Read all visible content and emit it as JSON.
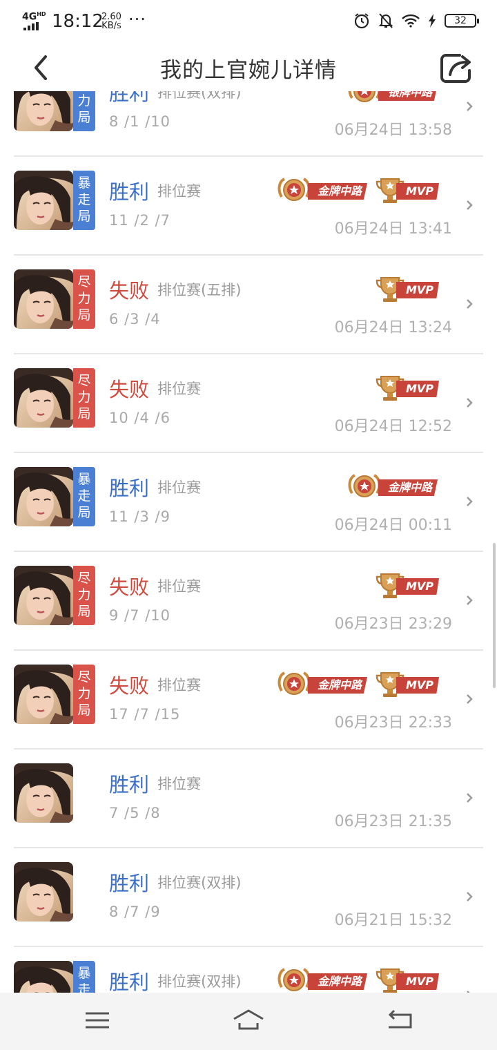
{
  "status_bar": {
    "network": "4G",
    "network_sup": "HD",
    "time": "18:12",
    "speed_value": "2.60",
    "speed_unit": "KB/s",
    "dots": "···",
    "battery": "32"
  },
  "header": {
    "title": "我的上官婉儿详情"
  },
  "matches": [
    {
      "result": "胜利",
      "outcome": "win",
      "mode": "排位赛(双排)",
      "kda": "8 /1 /10",
      "time": "06月24日 13:58",
      "tag": "尽力局",
      "tag_color": "blue",
      "badges": [
        {
          "type": "silver-medal",
          "label": "银牌中路"
        }
      ]
    },
    {
      "result": "胜利",
      "outcome": "win",
      "mode": "排位赛",
      "kda": "11 /2 /7",
      "time": "06月24日 13:41",
      "tag": "暴走局",
      "tag_color": "blue",
      "badges": [
        {
          "type": "gold-medal",
          "label": "金牌中路"
        },
        {
          "type": "mvp-trophy",
          "label": "MVP"
        }
      ]
    },
    {
      "result": "失败",
      "outcome": "lose",
      "mode": "排位赛(五排)",
      "kda": "6 /3 /4",
      "time": "06月24日 13:24",
      "tag": "尽力局",
      "tag_color": "red",
      "badges": [
        {
          "type": "mvp-trophy",
          "label": "MVP"
        }
      ]
    },
    {
      "result": "失败",
      "outcome": "lose",
      "mode": "排位赛",
      "kda": "10 /4 /6",
      "time": "06月24日 12:52",
      "tag": "尽力局",
      "tag_color": "red",
      "badges": [
        {
          "type": "mvp-trophy",
          "label": "MVP"
        }
      ]
    },
    {
      "result": "胜利",
      "outcome": "win",
      "mode": "排位赛",
      "kda": "11 /3 /9",
      "time": "06月24日 00:11",
      "tag": "暴走局",
      "tag_color": "blue",
      "badges": [
        {
          "type": "gold-medal",
          "label": "金牌中路"
        }
      ]
    },
    {
      "result": "失败",
      "outcome": "lose",
      "mode": "排位赛",
      "kda": "9 /7 /10",
      "time": "06月23日 23:29",
      "tag": "尽力局",
      "tag_color": "red",
      "badges": [
        {
          "type": "mvp-trophy",
          "label": "MVP"
        }
      ]
    },
    {
      "result": "失败",
      "outcome": "lose",
      "mode": "排位赛",
      "kda": "17 /7 /15",
      "time": "06月23日 22:33",
      "tag": "尽力局",
      "tag_color": "red",
      "badges": [
        {
          "type": "gold-medal",
          "label": "金牌中路"
        },
        {
          "type": "mvp-trophy",
          "label": "MVP"
        }
      ]
    },
    {
      "result": "胜利",
      "outcome": "win",
      "mode": "排位赛",
      "kda": "7 /5 /8",
      "time": "06月23日 21:35",
      "tag": "",
      "tag_color": "",
      "badges": []
    },
    {
      "result": "胜利",
      "outcome": "win",
      "mode": "排位赛(双排)",
      "kda": "8 /7 /9",
      "time": "06月21日 15:32",
      "tag": "",
      "tag_color": "",
      "badges": []
    },
    {
      "result": "胜利",
      "outcome": "win",
      "mode": "排位赛(双排)",
      "kda": "",
      "time": "",
      "tag": "暴走局",
      "tag_color": "blue",
      "badges": [
        {
          "type": "gold-medal",
          "label": "金牌中路"
        },
        {
          "type": "mvp-trophy",
          "label": "MVP"
        }
      ]
    }
  ],
  "colors": {
    "win": "#3b6fc7",
    "lose": "#cf4a3e",
    "tag_blue": "#4a7fd4",
    "tag_red": "#d9534a",
    "ribbon": "#c8433a",
    "medal_gold": "#c98a3c"
  },
  "navbar": {
    "items": [
      "menu-icon",
      "home-icon",
      "back-icon"
    ]
  }
}
